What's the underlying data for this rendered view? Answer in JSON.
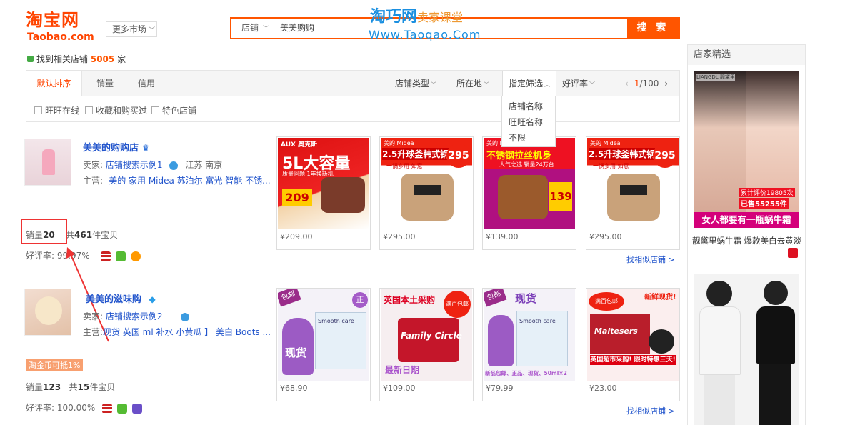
{
  "header": {
    "logo_cn": "淘宝网",
    "logo_en": "Taobao.com",
    "more_market": "更多市场",
    "search_type": "店铺",
    "search_value": "美美购购",
    "search_button": "搜 索",
    "watermark_cn": "淘巧网",
    "watermark_tag": "卖家课堂",
    "watermark_url": "Www.Taoqao.Com"
  },
  "result": {
    "prefix": "找到相关店铺",
    "count": "5005",
    "suffix": "家"
  },
  "sortbar": {
    "tabs": [
      "默认排序",
      "销量",
      "信用"
    ],
    "filters": {
      "type": "店铺类型",
      "location": "所在地",
      "specify": "指定筛选",
      "rating": "好评率"
    },
    "pager": {
      "current": "1",
      "total": "/100"
    }
  },
  "dropdown": [
    "店铺名称",
    "旺旺名称",
    "不限"
  ],
  "checkboxes": [
    "旺旺在线",
    "收藏和购买过",
    "特色店铺"
  ],
  "shops": [
    {
      "name": "美美的购购店",
      "seller_label": "卖家:",
      "seller": "店铺搜索示例1",
      "location": "江苏 南京",
      "main_label": "主营:",
      "main": "- 美的 家用 Midea 苏泊尔 富光 智能 不锈...",
      "sales_label": "销量",
      "sales": "20",
      "items_prefix": "共",
      "items": "461",
      "items_suffix": "件宝贝",
      "rate_label": "好评率:",
      "rate": "99.97%",
      "find_similar": "找相似店铺 >",
      "products": [
        {
          "price": "¥209.00",
          "banner": "5L大容量",
          "brand": "AUX 奥克斯",
          "sub": "质量问题 1年换新机",
          "tag": "209"
        },
        {
          "price": "¥295.00",
          "banner": "2.5升球釜韩式锅",
          "brand": "美的 Midea",
          "sub": "一锅多用 如意",
          "tag": "295"
        },
        {
          "price": "¥139.00",
          "banner": "不锈钢拉丝机身",
          "brand": "美的 Midea",
          "sub": "人气之选 销量24万台",
          "tag": "139"
        },
        {
          "price": "¥295.00",
          "banner": "2.5升球釜韩式锅",
          "brand": "美的 Midea",
          "sub": "一锅多用 如意",
          "tag": "295"
        }
      ]
    },
    {
      "name": "美美的滋味购",
      "seller_label": "卖家:",
      "seller": "店铺搜索示例2",
      "location": "",
      "main_label": "主营:",
      "main": "现货 英国 ml 补水 小黄瓜 】 美白 Boots ...",
      "promo": "淘金币可抵1%",
      "sales_label": "销量",
      "sales": "123",
      "items_prefix": "共",
      "items": "15",
      "items_suffix": "件宝贝",
      "rate_label": "好评率:",
      "rate": "100.00%",
      "find_similar": "找相似店铺 >",
      "products": [
        {
          "price": "¥68.90",
          "banner": "现货",
          "badge": "包邮",
          "brand": "Smooth care",
          "tag": "正"
        },
        {
          "price": "¥109.00",
          "banner": "英国本土采购",
          "badge": "满百包邮",
          "brand": "Family Circle",
          "tag": "最新日期"
        },
        {
          "price": "¥79.99",
          "banner": "现货",
          "badge": "包邮",
          "brand": "Smooth care",
          "tag": "新品包邮、正品、现货、50ml×2"
        },
        {
          "price": "¥23.00",
          "banner": "新鲜现货!",
          "badge": "满百包邮",
          "brand": "Maltesers",
          "tag": "英国超市采购! 限时特惠三天!"
        }
      ]
    }
  ],
  "sidebar": {
    "title": "店家精选",
    "ad1_brand": "LIANGDL 靓黛里",
    "ad1_stat1": "累计评价19805次",
    "ad1_stat2": "已售55255件",
    "ad1_slogan": "女人都要有一瓶蜗牛霜",
    "ad1_caption": "靓黛里蜗牛霜 爆款美白去黄淡"
  },
  "colors": {
    "brand": "#ff4400",
    "link": "#2255cc",
    "annotation": "#ee3333"
  }
}
